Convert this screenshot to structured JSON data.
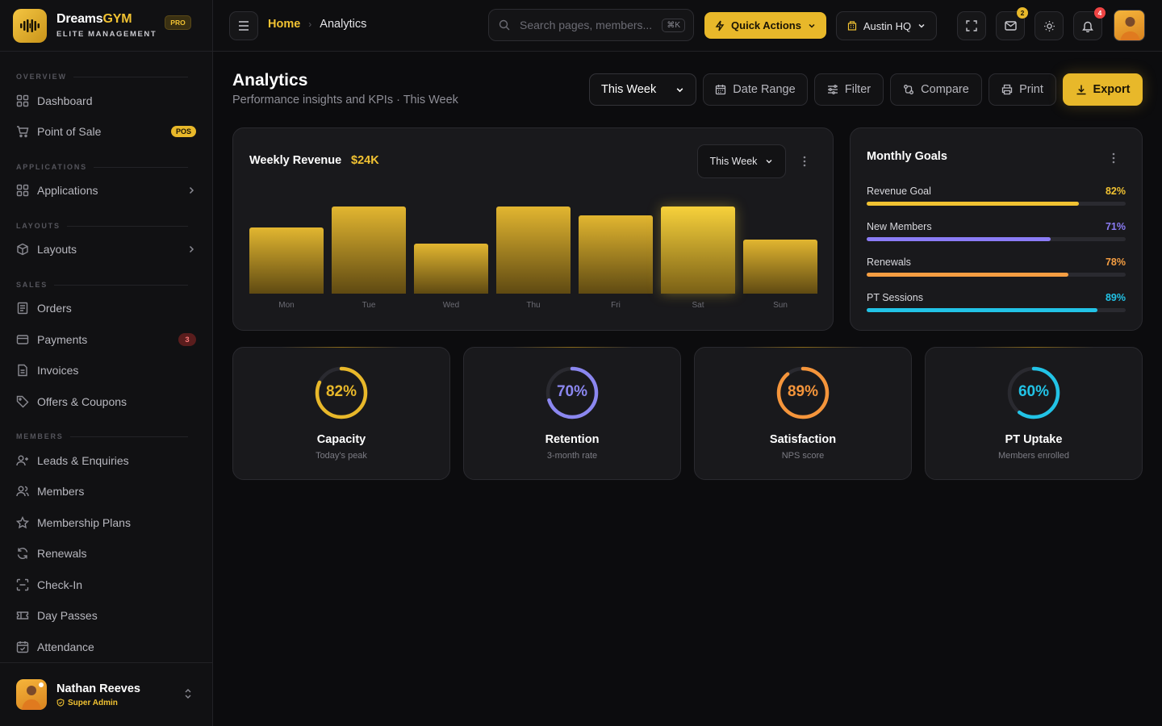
{
  "brand": {
    "name_a": "Dreams",
    "name_b": "GYM",
    "subtitle": "ELITE MANAGEMENT",
    "badge": "PRO"
  },
  "sidebar": {
    "sections": [
      "OVERVIEW",
      "APPLICATIONS",
      "LAYOUTS",
      "SALES",
      "MEMBERS"
    ],
    "items": [
      {
        "label": "Dashboard",
        "icon": "grid-icon"
      },
      {
        "label": "Point of Sale",
        "icon": "cart-icon",
        "badge": "POS"
      },
      {
        "label": "Applications",
        "icon": "apps-icon"
      },
      {
        "label": "Layouts",
        "icon": "cube-icon"
      },
      {
        "label": "Orders",
        "icon": "receipt-icon"
      },
      {
        "label": "Payments",
        "icon": "card-icon",
        "badge": "3"
      },
      {
        "label": "Invoices",
        "icon": "document-icon"
      },
      {
        "label": "Offers & Coupons",
        "icon": "tag-icon"
      },
      {
        "label": "Leads & Enquiries",
        "icon": "user-plus-icon"
      },
      {
        "label": "Members",
        "icon": "users-icon"
      },
      {
        "label": "Membership Plans",
        "icon": "star-icon"
      },
      {
        "label": "Renewals",
        "icon": "refresh-icon"
      },
      {
        "label": "Check-In",
        "icon": "scan-icon"
      },
      {
        "label": "Day Passes",
        "icon": "ticket-icon"
      },
      {
        "label": "Attendance",
        "icon": "calendar-check-icon"
      }
    ]
  },
  "user": {
    "name": "Nathan Reeves",
    "role": "Super Admin"
  },
  "header": {
    "breadcrumb_home": "Home",
    "breadcrumb_current": "Analytics",
    "search_placeholder": "Search pages, members...",
    "search_shortcut": "⌘K",
    "quick_actions": "Quick Actions",
    "location": "Austin HQ",
    "mail_count": "2",
    "notif_count": "4"
  },
  "page": {
    "title": "Analytics",
    "subtitle": "Performance insights and KPIs · This Week",
    "period": "This Week",
    "date_range": "Date Range",
    "filter": "Filter",
    "compare": "Compare",
    "print": "Print",
    "export": "Export"
  },
  "revenue": {
    "title": "Weekly Revenue",
    "total": "$24K",
    "period": "This Week"
  },
  "chart_data": {
    "type": "bar",
    "categories": [
      "Mon",
      "Tue",
      "Wed",
      "Thu",
      "Fri",
      "Sat",
      "Sun"
    ],
    "values": [
      76,
      100,
      57,
      100,
      90,
      100,
      62
    ],
    "ylim": [
      0,
      100
    ],
    "highlight": "Sat",
    "color": "#e8b82a"
  },
  "goals": {
    "title": "Monthly Goals",
    "items": [
      {
        "name": "Revenue Goal",
        "pct": "82%",
        "value": 82,
        "color": "#f1c232"
      },
      {
        "name": "New Members",
        "pct": "71%",
        "value": 71,
        "color": "#8b7cf6"
      },
      {
        "name": "Renewals",
        "pct": "78%",
        "value": 78,
        "color": "#f59e42"
      },
      {
        "name": "PT Sessions",
        "pct": "89%",
        "value": 89,
        "color": "#22c3e6"
      }
    ]
  },
  "kpis": [
    {
      "pct": "82%",
      "value": 82,
      "title": "Capacity",
      "sub": "Today's peak",
      "color": "#e8b82a"
    },
    {
      "pct": "70%",
      "value": 70,
      "title": "Retention",
      "sub": "3-month rate",
      "color": "#8b87f0"
    },
    {
      "pct": "89%",
      "value": 89,
      "title": "Satisfaction",
      "sub": "NPS score",
      "color": "#f5953b"
    },
    {
      "pct": "60%",
      "value": 60,
      "title": "PT Uptake",
      "sub": "Members enrolled",
      "color": "#22c3e6"
    }
  ]
}
